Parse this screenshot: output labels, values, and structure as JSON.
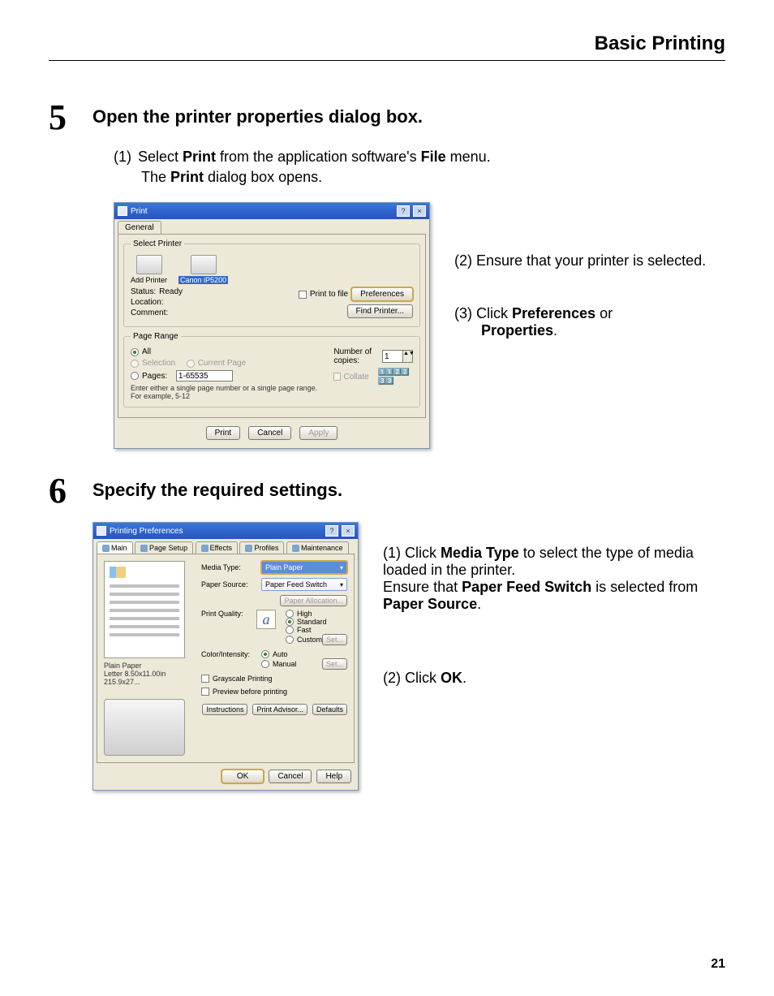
{
  "header": {
    "title": "Basic Printing"
  },
  "step5": {
    "num": "5",
    "heading": "Open the printer properties dialog box.",
    "sub1_key": "(1)",
    "sub1_pre": "Select ",
    "sub1_b1": "Print",
    "sub1_mid": " from the application software's ",
    "sub1_b2": "File",
    "sub1_post": " menu.",
    "note_pre": "The ",
    "note_b": "Print",
    "note_post": " dialog box opens."
  },
  "printDialog": {
    "title": "Print",
    "tab": "General",
    "fs_select": "Select Printer",
    "add_printer": "Add Printer",
    "printer_name": "Canon iP5200",
    "status_l": "Status:",
    "status_v": "Ready",
    "loc_l": "Location:",
    "com_l": "Comment:",
    "print_to_file": "Print to file",
    "pref_btn": "Preferences",
    "find_btn": "Find Printer...",
    "fs_range": "Page Range",
    "r_all": "All",
    "r_sel": "Selection",
    "r_cur": "Current Page",
    "r_pages": "Pages:",
    "r_pages_val": "1-65535",
    "r_note": "Enter either a single page number or a single page range. For example, 5-12",
    "copies_l": "Number of copies:",
    "copies_v": "1",
    "collate": "Collate",
    "btn_print": "Print",
    "btn_cancel": "Cancel",
    "btn_apply": "Apply"
  },
  "callouts5": {
    "c2_pre": "(2) Ensure that your printer is selected.",
    "c3_pre": "(3) Click ",
    "c3_b": "Preferences",
    "c3_mid": " or ",
    "c3_b2": "Properties",
    "c3_post": "."
  },
  "step6": {
    "num": "6",
    "heading": "Specify the required settings."
  },
  "prefDialog": {
    "title": "Printing Preferences",
    "tabs": {
      "main": "Main",
      "page": "Page Setup",
      "eff": "Effects",
      "prof": "Profiles",
      "maint": "Maintenance"
    },
    "media_l": "Media Type:",
    "media_v": "Plain Paper",
    "src_l": "Paper Source:",
    "src_v": "Paper Feed Switch",
    "alloc_btn": "Paper Allocation...",
    "pq_l": "Print Quality:",
    "pq_high": "High",
    "pq_std": "Standard",
    "pq_fast": "Fast",
    "pq_custom": "Custom",
    "set_btn": "Set...",
    "ci_l": "Color/Intensity:",
    "ci_auto": "Auto",
    "ci_manual": "Manual",
    "gray": "Grayscale Printing",
    "preview": "Preview before printing",
    "instr_btn": "Instructions",
    "adv_btn": "Print Advisor...",
    "def_btn": "Defaults",
    "ok": "OK",
    "cancel": "Cancel",
    "help": "Help",
    "prev_name": "Plain Paper",
    "prev_size": "Letter 8.50x11.00in 215.9x27..."
  },
  "callouts6": {
    "c1_pre": "(1) Click ",
    "c1_b": "Media Type",
    "c1_post": " to select the type of media loaded in the printer.",
    "c1b_pre": "Ensure that ",
    "c1b_b": "Paper Feed Switch",
    "c1b_mid": " is selected from ",
    "c1b_b2": "Paper Source",
    "c1b_post": ".",
    "c2_pre": "(2) Click ",
    "c2_b": "OK",
    "c2_post": "."
  },
  "page_num": "21"
}
